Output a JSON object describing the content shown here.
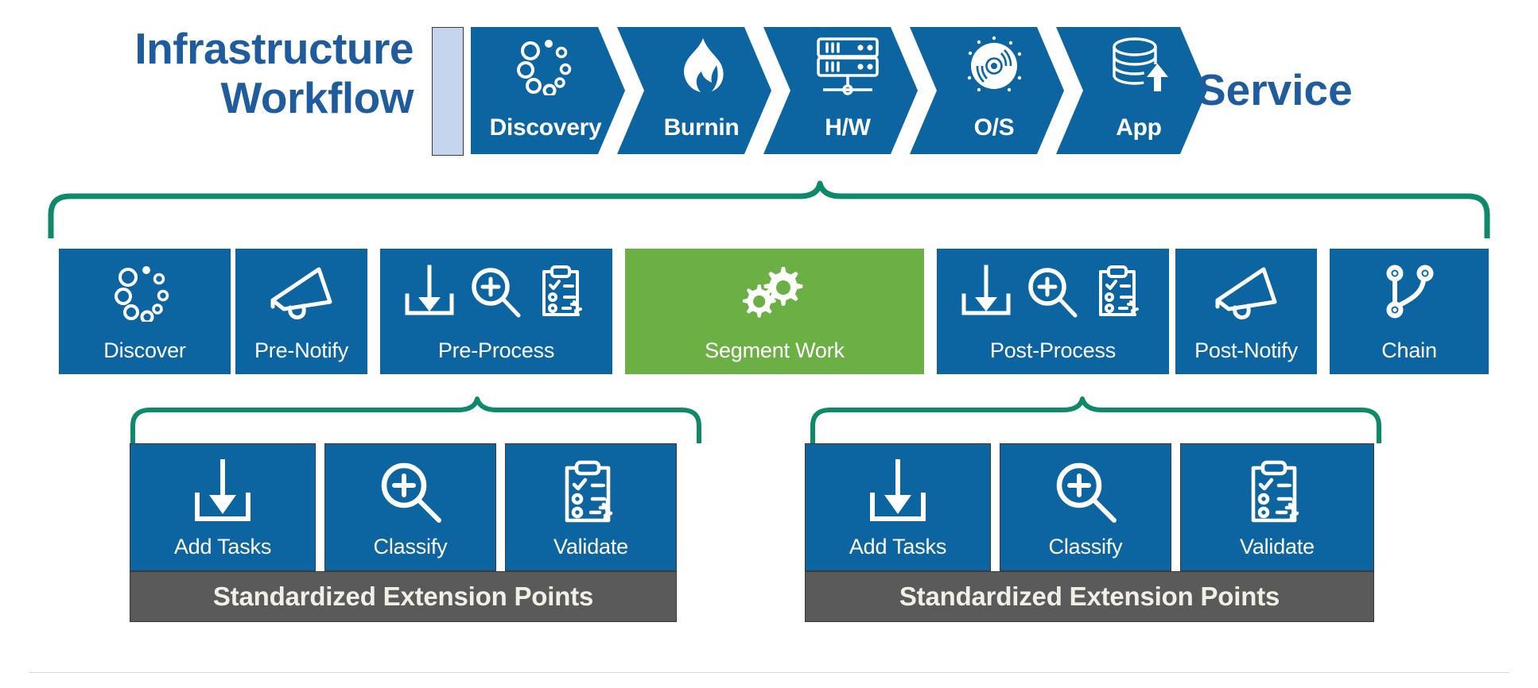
{
  "title": {
    "line1": "Infrastructure",
    "line2": "Workflow",
    "service_label": "Service"
  },
  "colors": {
    "blue": "#0C64A0",
    "green": "#6CAF44",
    "brace_green": "#0E8a6b",
    "gray": "#5A5A5A",
    "title_blue": "#1F5C9E",
    "pale_blue": "#C5D5EE"
  },
  "workflow_stages": [
    {
      "label": "Discovery",
      "icon": "discovery-dots-icon"
    },
    {
      "label": "Burnin",
      "icon": "flame-icon"
    },
    {
      "label": "H/W",
      "icon": "server-rack-icon"
    },
    {
      "label": "O/S",
      "icon": "disc-icon"
    },
    {
      "label": "App",
      "icon": "database-upload-icon"
    }
  ],
  "pipeline_tiles": [
    {
      "label": "Discover",
      "icon": "discovery-dots-icon",
      "color": "blue"
    },
    {
      "label": "Pre-Notify",
      "icon": "megaphone-icon",
      "color": "blue"
    },
    {
      "label": "Pre-Process",
      "icon": "add-classify-validate-icons",
      "color": "blue"
    },
    {
      "label": "Segment Work",
      "icon": "gears-icon",
      "color": "green"
    },
    {
      "label": "Post-Process",
      "icon": "add-classify-validate-icons",
      "color": "blue"
    },
    {
      "label": "Post-Notify",
      "icon": "megaphone-icon",
      "color": "blue"
    },
    {
      "label": "Chain",
      "icon": "branch-icon",
      "color": "blue"
    }
  ],
  "extension_groups": [
    {
      "bar_label": "Standardized Extension Points",
      "items": [
        {
          "label": "Add Tasks",
          "icon": "arrow-into-tray-icon"
        },
        {
          "label": "Classify",
          "icon": "magnifier-plus-icon"
        },
        {
          "label": "Validate",
          "icon": "clipboard-refresh-icon"
        }
      ]
    },
    {
      "bar_label": "Standardized Extension Points",
      "items": [
        {
          "label": "Add Tasks",
          "icon": "arrow-into-tray-icon"
        },
        {
          "label": "Classify",
          "icon": "magnifier-plus-icon"
        },
        {
          "label": "Validate",
          "icon": "clipboard-refresh-icon"
        }
      ]
    }
  ]
}
